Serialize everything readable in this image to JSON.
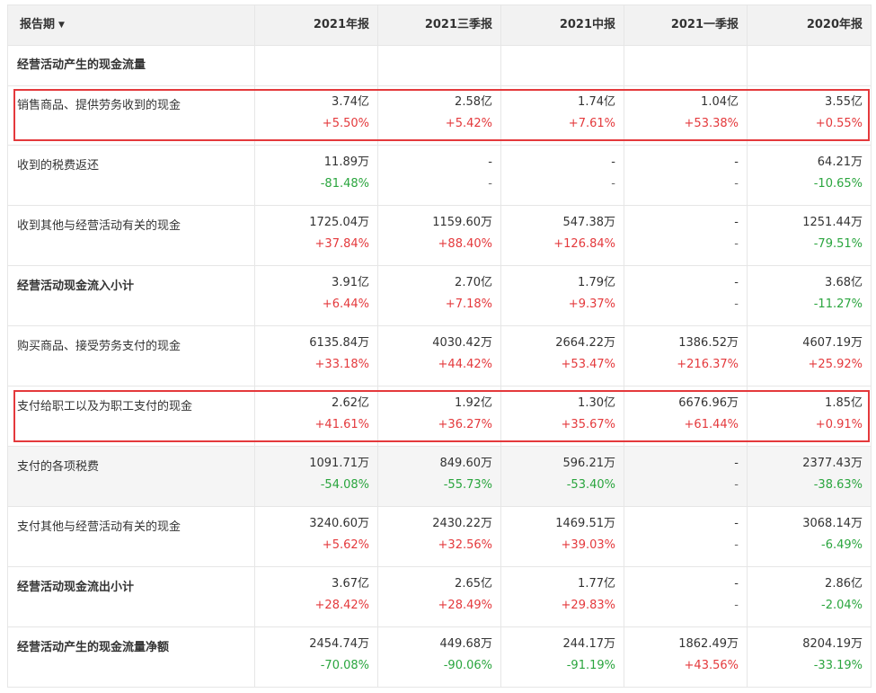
{
  "header": {
    "period_label": "报告期",
    "period_caret": "▼",
    "columns": [
      "2021年报",
      "2021三季报",
      "2021中报",
      "2021一季报",
      "2020年报"
    ]
  },
  "section_title": "经营活动产生的现金流量",
  "rows": [
    {
      "label": "销售商品、提供劳务收到的现金",
      "bold": false,
      "highlight": true,
      "shade": false,
      "values": [
        "3.74亿",
        "2.58亿",
        "1.74亿",
        "1.04亿",
        "3.55亿"
      ],
      "changes": [
        "+5.50%",
        "+5.42%",
        "+7.61%",
        "+53.38%",
        "+0.55%"
      ]
    },
    {
      "label": "收到的税费返还",
      "bold": false,
      "highlight": false,
      "shade": false,
      "values": [
        "11.89万",
        "-",
        "-",
        "-",
        "64.21万"
      ],
      "changes": [
        "-81.48%",
        "-",
        "-",
        "-",
        "-10.65%"
      ]
    },
    {
      "label": "收到其他与经营活动有关的现金",
      "bold": false,
      "highlight": false,
      "shade": false,
      "values": [
        "1725.04万",
        "1159.60万",
        "547.38万",
        "-",
        "1251.44万"
      ],
      "changes": [
        "+37.84%",
        "+88.40%",
        "+126.84%",
        "-",
        "-79.51%"
      ]
    },
    {
      "label": "经营活动现金流入小计",
      "bold": true,
      "highlight": false,
      "shade": false,
      "values": [
        "3.91亿",
        "2.70亿",
        "1.79亿",
        "-",
        "3.68亿"
      ],
      "changes": [
        "+6.44%",
        "+7.18%",
        "+9.37%",
        "-",
        "-11.27%"
      ]
    },
    {
      "label": "购买商品、接受劳务支付的现金",
      "bold": false,
      "highlight": false,
      "shade": false,
      "values": [
        "6135.84万",
        "4030.42万",
        "2664.22万",
        "1386.52万",
        "4607.19万"
      ],
      "changes": [
        "+33.18%",
        "+44.42%",
        "+53.47%",
        "+216.37%",
        "+25.92%"
      ]
    },
    {
      "label": "支付给职工以及为职工支付的现金",
      "bold": false,
      "highlight": true,
      "shade": false,
      "values": [
        "2.62亿",
        "1.92亿",
        "1.30亿",
        "6676.96万",
        "1.85亿"
      ],
      "changes": [
        "+41.61%",
        "+36.27%",
        "+35.67%",
        "+61.44%",
        "+0.91%"
      ]
    },
    {
      "label": "支付的各项税费",
      "bold": false,
      "highlight": false,
      "shade": true,
      "values": [
        "1091.71万",
        "849.60万",
        "596.21万",
        "-",
        "2377.43万"
      ],
      "changes": [
        "-54.08%",
        "-55.73%",
        "-53.40%",
        "-",
        "-38.63%"
      ]
    },
    {
      "label": "支付其他与经营活动有关的现金",
      "bold": false,
      "highlight": false,
      "shade": false,
      "values": [
        "3240.60万",
        "2430.22万",
        "1469.51万",
        "-",
        "3068.14万"
      ],
      "changes": [
        "+5.62%",
        "+32.56%",
        "+39.03%",
        "-",
        "-6.49%"
      ]
    },
    {
      "label": "经营活动现金流出小计",
      "bold": true,
      "highlight": false,
      "shade": false,
      "values": [
        "3.67亿",
        "2.65亿",
        "1.77亿",
        "-",
        "2.86亿"
      ],
      "changes": [
        "+28.42%",
        "+28.49%",
        "+29.83%",
        "-",
        "-2.04%"
      ]
    },
    {
      "label": "经营活动产生的现金流量净额",
      "bold": true,
      "highlight": false,
      "shade": false,
      "values": [
        "2454.74万",
        "449.68万",
        "244.17万",
        "1862.49万",
        "8204.19万"
      ],
      "changes": [
        "-70.08%",
        "-90.06%",
        "-91.19%",
        "+43.56%",
        "-33.19%"
      ]
    }
  ],
  "colors": {
    "increase": "#e4393c",
    "decrease": "#2aa53e",
    "highlight_border": "#e4393c",
    "header_bg": "#f2f2f2"
  }
}
